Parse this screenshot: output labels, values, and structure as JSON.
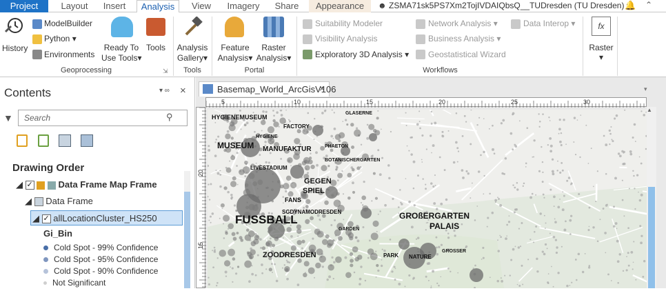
{
  "ribbon_tabs": [
    "Project",
    "Layout",
    "Insert",
    "Analysis",
    "View",
    "Imagery",
    "Share",
    "Appearance"
  ],
  "account": "ZSMA71sk5PS7Xm2TojIVDAIQbsQ__TUDresden (TU Dresden)",
  "ribbon": {
    "history": "History",
    "modelbuilder": "ModelBuilder",
    "python": "Python",
    "environments": "Environments",
    "ready_to_use": "Ready To",
    "ready_to_use2": "Use Tools",
    "tools": "Tools",
    "analysis_gallery": "Analysis",
    "analysis_gallery2": "Gallery",
    "feature_analysis": "Feature",
    "feature_analysis2": "Analysis",
    "raster_analysis": "Raster",
    "raster_analysis2": "Analysis",
    "suitability": "Suitability Modeler",
    "visibility": "Visibility Analysis",
    "explore3d": "Exploratory 3D Analysis",
    "network": "Network Analysis",
    "business": "Business Analysis",
    "geostat": "Geostatistical Wizard",
    "data_interop": "Data Interop",
    "raster": "Raster",
    "groups": {
      "geoprocessing": "Geoprocessing",
      "tools": "Tools",
      "portal": "Portal",
      "workflows": "Workflows"
    }
  },
  "contents": {
    "title": "Contents",
    "search_placeholder": "Search",
    "drawing_order": "Drawing Order",
    "map_frame": "Data Frame Map Frame",
    "data_frame": "Data Frame",
    "layer": "allLocationCluster_HS250",
    "field": "Gi_Bin",
    "legend": [
      {
        "label": "Cold Spot - 99% Confidence",
        "color": "#4a6fa8"
      },
      {
        "label": "Cold Spot - 95% Confidence",
        "color": "#7f96bf"
      },
      {
        "label": "Cold Spot - 90% Confidence",
        "color": "#b6c3da"
      },
      {
        "label": "Not Significant",
        "color": "#cfcfcf"
      }
    ]
  },
  "map": {
    "tab_title": "Basemap_World_ArcGisV106",
    "ruler_ticks": [
      "5",
      "10",
      "15",
      "20",
      "25",
      "30"
    ],
    "vruler_ticks": [
      "20",
      "15"
    ],
    "labels": [
      {
        "text": "HYGIENEMUSEUM",
        "size": 9
      },
      {
        "text": "FACTORY",
        "size": 8
      },
      {
        "text": "MUSEUM",
        "size": 12
      },
      {
        "text": "MANUFAKTUR",
        "size": 10
      },
      {
        "text": "LIVESTADIUM",
        "size": 8
      },
      {
        "text": "GEGEN",
        "size": 11
      },
      {
        "text": "SPIEL",
        "size": 11
      },
      {
        "text": "FANS",
        "size": 9
      },
      {
        "text": "SGDYNAMODRESDEN",
        "size": 8
      },
      {
        "text": "FUSSBALL",
        "size": 17
      },
      {
        "text": "GROßERGARTEN",
        "size": 12
      },
      {
        "text": "PALAIS",
        "size": 12
      },
      {
        "text": "ZOODRESDEN",
        "size": 11
      },
      {
        "text": "PARK",
        "size": 8
      },
      {
        "text": "NATURE",
        "size": 8
      },
      {
        "text": "BOTANISCHERGARTEN",
        "size": 7
      },
      {
        "text": "GLASERNE",
        "size": 7
      },
      {
        "text": "HYGIENE",
        "size": 7
      },
      {
        "text": "PHAETON",
        "size": 7
      },
      {
        "text": "GARDEN",
        "size": 7
      },
      {
        "text": "GROSSER",
        "size": 7
      }
    ]
  }
}
